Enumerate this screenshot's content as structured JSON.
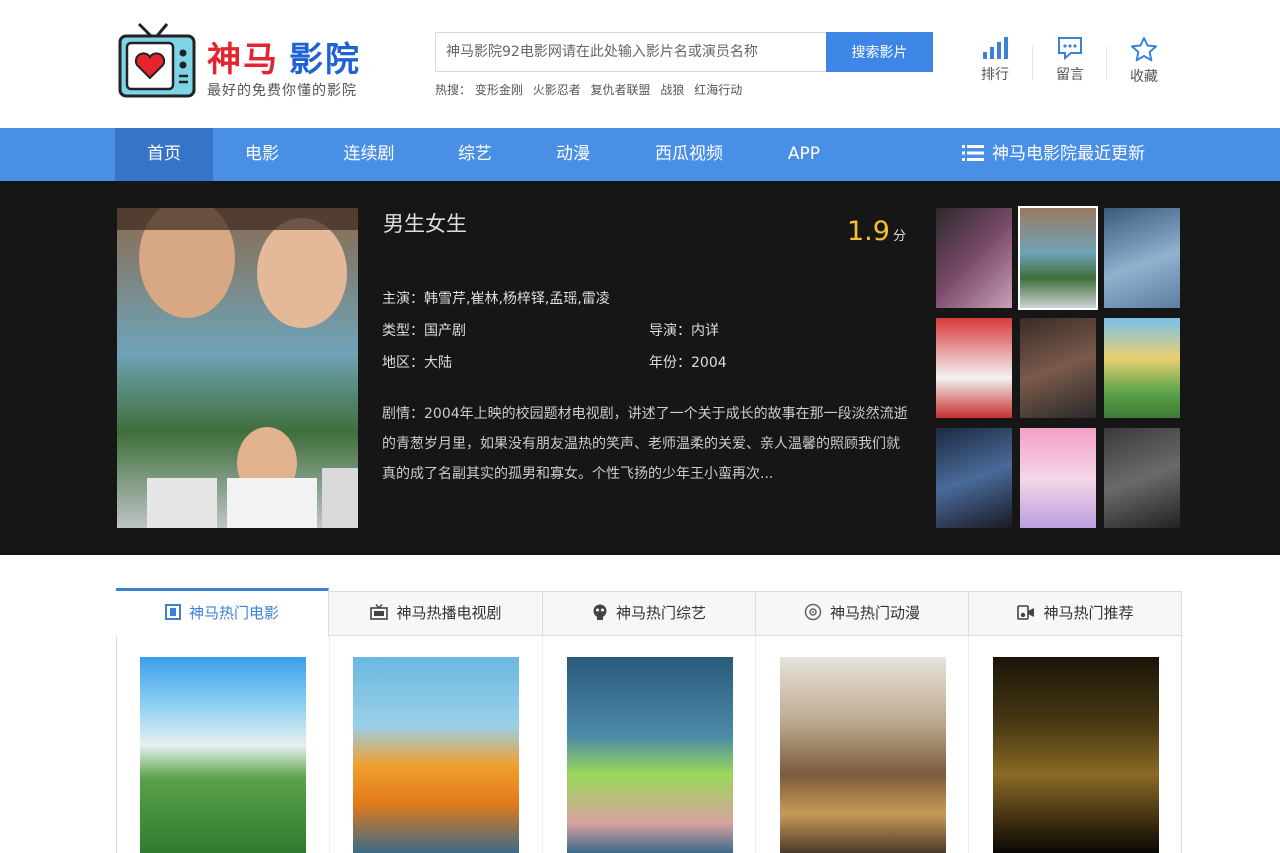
{
  "logo": {
    "title_a": "神马",
    "title_b": "影院",
    "subtitle": "最好的免费你懂的影院"
  },
  "search": {
    "placeholder": "神马影院92电影网请在此处输入影片名或演员名称",
    "button": "搜索影片",
    "hot_label": "热搜：",
    "hot_terms": [
      "变形金刚",
      "火影忍者",
      "复仇者联盟",
      "战狼",
      "红海行动"
    ]
  },
  "tools": [
    {
      "label": "排行",
      "icon": "bar-chart-icon"
    },
    {
      "label": "留言",
      "icon": "message-icon"
    },
    {
      "label": "收藏",
      "icon": "star-icon"
    }
  ],
  "nav": {
    "items": [
      "首页",
      "电影",
      "连续剧",
      "综艺",
      "动漫",
      "西瓜视频",
      "APP"
    ],
    "active_index": 0,
    "recent": "神马电影院最近更新"
  },
  "featured": {
    "title": "男生女生",
    "score": "1.9",
    "score_unit": "分",
    "actors": "主演：韩雪芹,崔林,杨梓铎,孟瑶,雷凌",
    "genre": "类型：国产剧",
    "director": "导演：内详",
    "region": "地区：大陆",
    "year": "年份：2004",
    "plot": "剧情：2004年上映的校园题材电视剧，讲述了一个关于成长的故事在那一段淡然流逝的青葱岁月里，如果没有朋友温热的笑声、老师温柔的关爱、亲人温馨的照顾我们就真的成了名副其实的孤男和寡女。个性飞扬的少年王小蛮再次..."
  },
  "tabs": [
    {
      "label": "神马热门电影",
      "icon": "film-icon"
    },
    {
      "label": "神马热播电视剧",
      "icon": "tv-icon"
    },
    {
      "label": "神马热门综艺",
      "icon": "mask-icon"
    },
    {
      "label": "神马热门动漫",
      "icon": "disc-icon"
    },
    {
      "label": "神马热门推荐",
      "icon": "camera-icon"
    }
  ],
  "colors": {
    "nav_bg": "#4a8fe6",
    "nav_active": "#3674c8",
    "search_button": "#3d86e6",
    "hero_bg": "#161616",
    "score": "#f2c230",
    "tab_active": "#3b82d6"
  }
}
